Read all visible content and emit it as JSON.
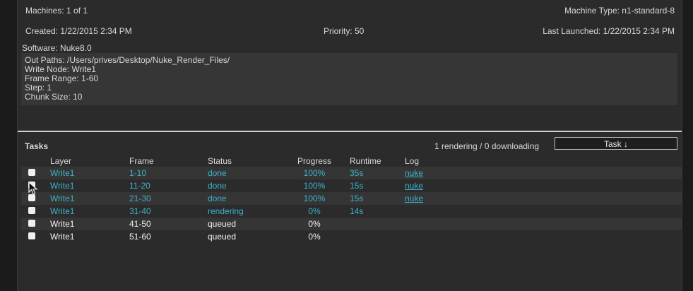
{
  "header": {
    "machines": "Machines: 1 of 1",
    "machine_type": "Machine Type: n1-standard-8",
    "created": "Created: 1/22/2015 2:34 PM",
    "priority": "Priority: 50",
    "last_launched": "Last Launched: 1/22/2015 2:34 PM",
    "software": "Software: Nuke8.0"
  },
  "details": {
    "out_paths": "Out Paths: /Users/prives/Desktop/Nuke_Render_Files/",
    "write_node": "Write Node: Write1",
    "frame_range": "Frame Range: 1-60",
    "step": "Step: 1",
    "chunk_size": "Chunk Size: 10"
  },
  "tasks": {
    "title": "Tasks",
    "summary": "1 rendering / 0 downloading",
    "task_button": "Task ↓",
    "columns": [
      "Layer",
      "Frame",
      "Status",
      "Progress",
      "Runtime",
      "Log"
    ],
    "rows": [
      {
        "layer": "Write1",
        "frame": "1-10",
        "status": "done",
        "progress": "100%",
        "runtime": "35s",
        "log": "nuke"
      },
      {
        "layer": "Write1",
        "frame": "11-20",
        "status": "done",
        "progress": "100%",
        "runtime": "15s",
        "log": "nuke"
      },
      {
        "layer": "Write1",
        "frame": "21-30",
        "status": "done",
        "progress": "100%",
        "runtime": "15s",
        "log": "nuke"
      },
      {
        "layer": "Write1",
        "frame": "31-40",
        "status": "rendering",
        "progress": "0%",
        "runtime": "14s",
        "log": ""
      },
      {
        "layer": "Write1",
        "frame": "41-50",
        "status": "queued",
        "progress": "0%",
        "runtime": "",
        "log": ""
      },
      {
        "layer": "Write1",
        "frame": "51-60",
        "status": "queued",
        "progress": "0%",
        "runtime": "",
        "log": ""
      }
    ]
  },
  "colors": {
    "active_text": "#3fb0c9",
    "queued_text": "#f2f2f2"
  }
}
